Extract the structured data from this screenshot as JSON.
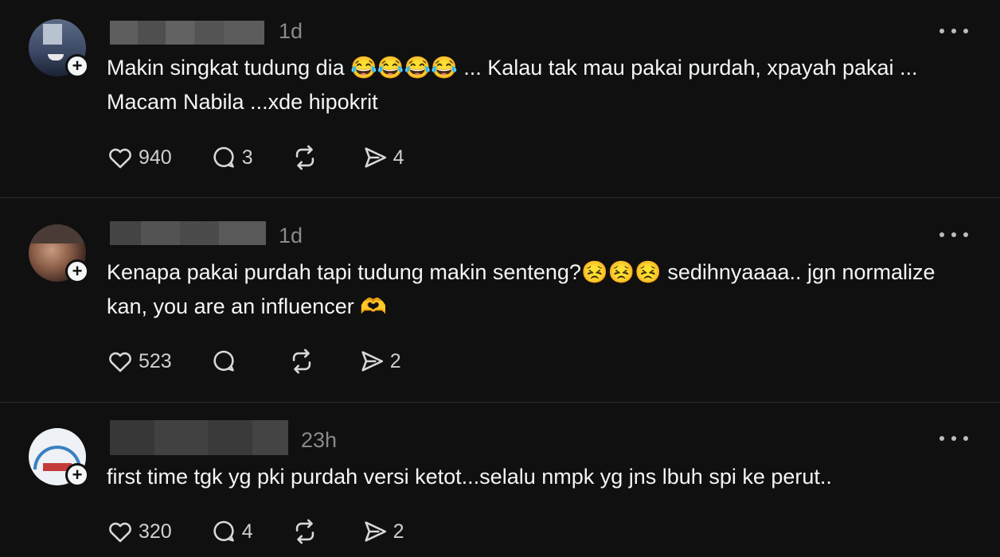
{
  "posts": [
    {
      "time": "1d",
      "text_parts": [
        "Makin singkat tudung dia ",
        " ... Kalau tak mau pakai purdah, xpayah pakai ... Macam Nabila ...xde hipokrit"
      ],
      "emoji": "😂😂😂😂",
      "likes": "940",
      "replies": "3",
      "reposts": "",
      "shares": "4"
    },
    {
      "time": "1d",
      "text_parts": [
        "Kenapa pakai purdah tapi tudung makin senteng?",
        " sedihnyaaaa.. jgn normalize kan, you are an influencer "
      ],
      "emoji": "😣😣😣",
      "emoji2": "🫶",
      "likes": "523",
      "replies": "",
      "reposts": "",
      "shares": "2"
    },
    {
      "time": "23h",
      "text_parts": [
        "first time tgk yg pki purdah versi ketot...selalu nmpk yg jns lbuh spi ke perut.."
      ],
      "likes": "320",
      "replies": "4",
      "reposts": "",
      "shares": "2"
    }
  ],
  "colors": {
    "background": "#101010",
    "text": "#f3f5f7",
    "muted": "#8a8a8a",
    "divider": "#2e2e2e"
  },
  "icons": [
    "heart-icon",
    "reply-icon",
    "repost-icon",
    "share-icon",
    "more-icon",
    "follow-plus-icon"
  ]
}
